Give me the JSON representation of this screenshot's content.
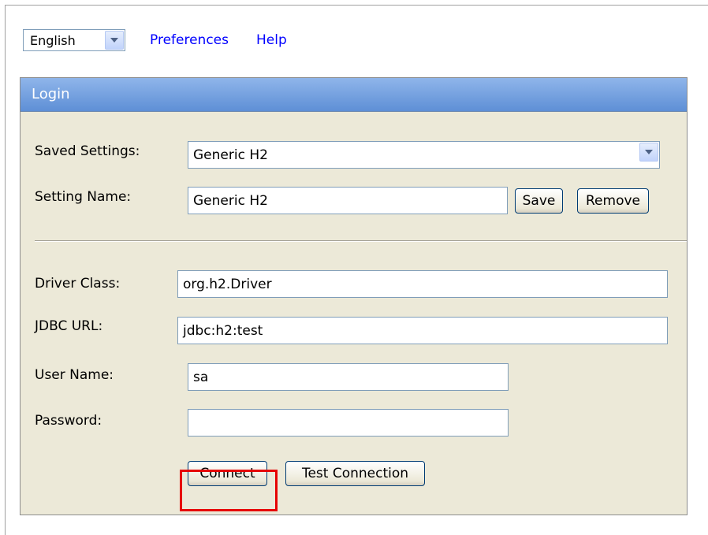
{
  "top_bar": {
    "language": "English",
    "preferences_link": "Preferences",
    "help_link": "Help"
  },
  "login": {
    "title": "Login",
    "saved_settings_label": "Saved Settings:",
    "saved_settings_value": "Generic H2",
    "setting_name_label": "Setting Name:",
    "setting_name_value": "Generic H2",
    "save_button": "Save",
    "remove_button": "Remove",
    "driver_class_label": "Driver Class:",
    "driver_class_value": "org.h2.Driver",
    "jdbc_url_label": "JDBC URL:",
    "jdbc_url_value": "jdbc:h2:test",
    "user_name_label": "User Name:",
    "user_name_value": "sa",
    "password_label": "Password:",
    "password_value": "",
    "connect_button": "Connect",
    "test_connection_button": "Test Connection"
  },
  "colors": {
    "link": "#0000ff",
    "header_top": "#8fb5ea",
    "header_bottom": "#5e8fd6",
    "panel_bg": "#ece9d8",
    "highlight": "#e60000"
  }
}
